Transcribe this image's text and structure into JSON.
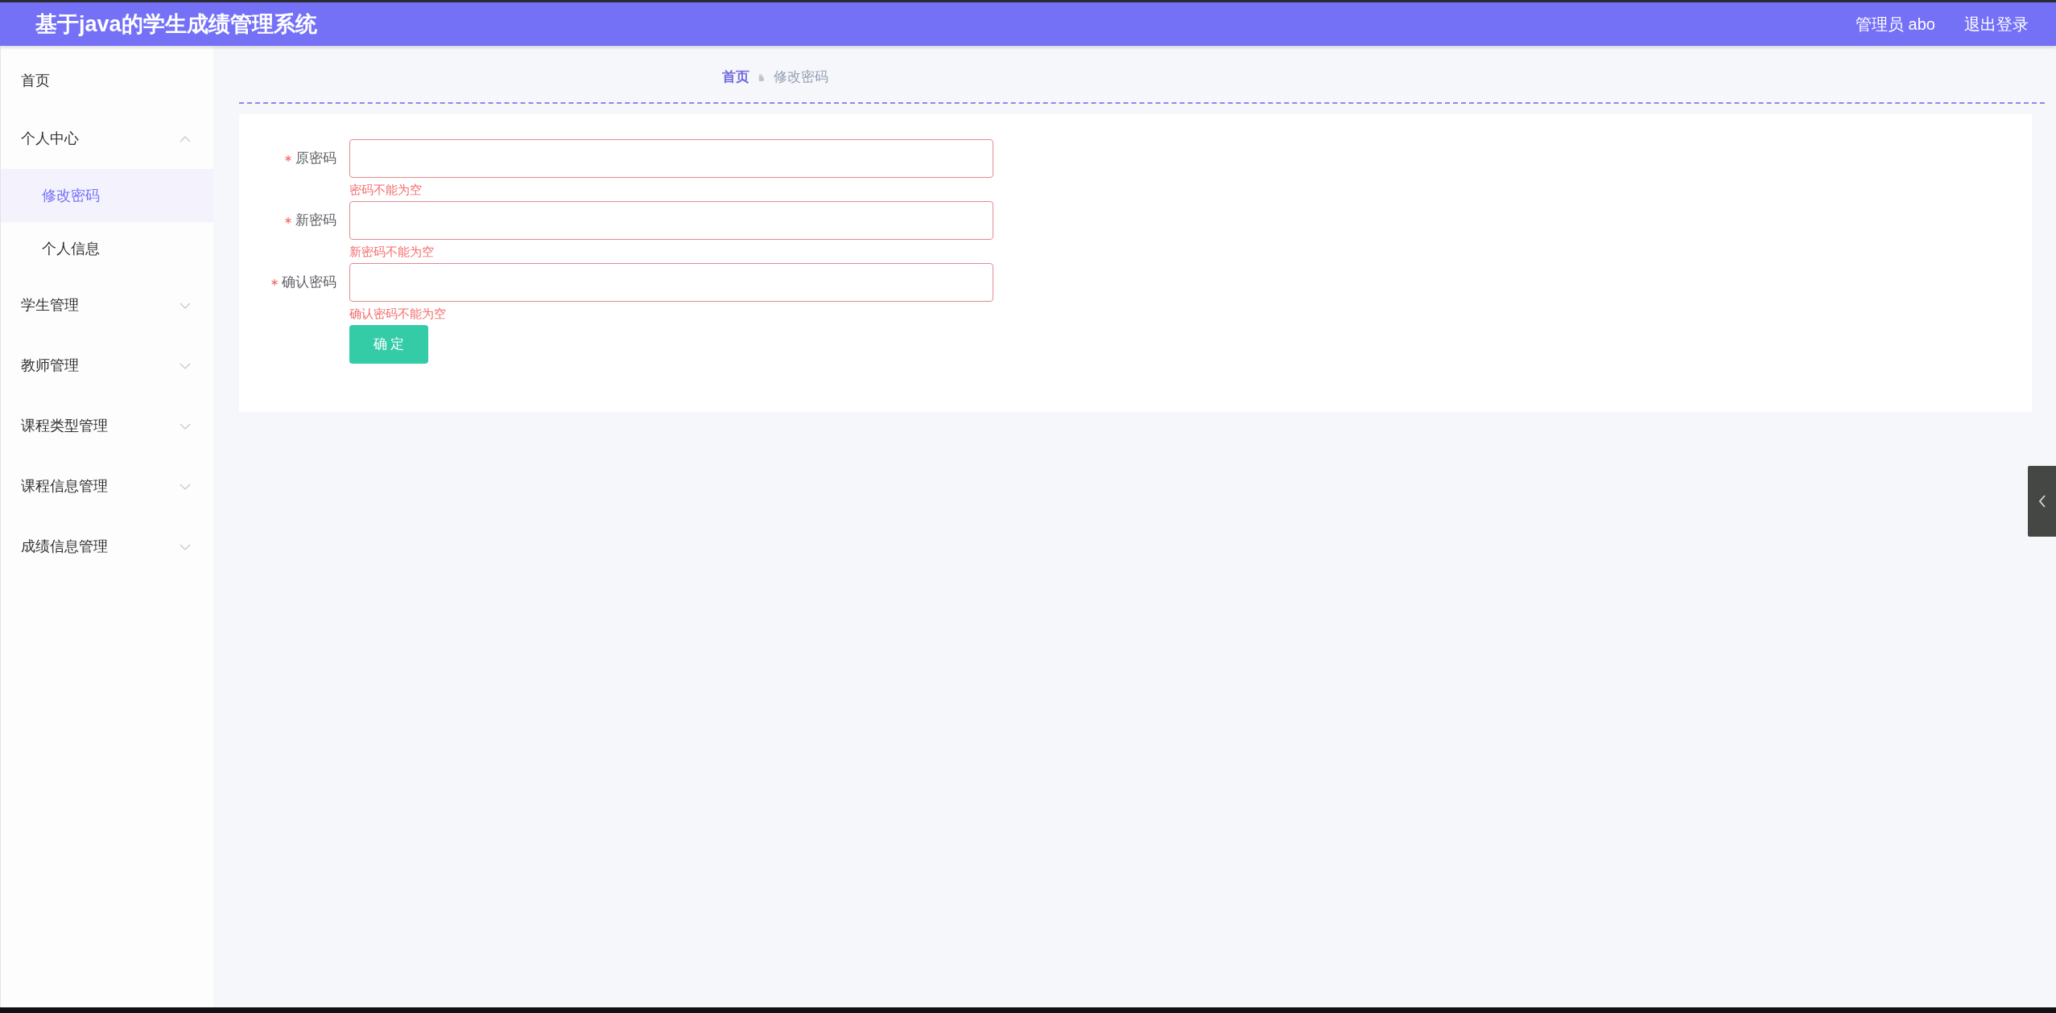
{
  "header": {
    "title": "基于java的学生成绩管理系统",
    "user": "管理员 abo",
    "logout": "退出登录"
  },
  "sidebar": {
    "items": [
      {
        "label": "首页",
        "kind": "link",
        "selected": false
      },
      {
        "label": "个人中心",
        "kind": "group",
        "expanded": true,
        "children": [
          {
            "label": "修改密码",
            "selected": true
          },
          {
            "label": "个人信息",
            "selected": false
          }
        ]
      },
      {
        "label": "学生管理",
        "kind": "group",
        "expanded": false
      },
      {
        "label": "教师管理",
        "kind": "group",
        "expanded": false
      },
      {
        "label": "课程类型管理",
        "kind": "group",
        "expanded": false
      },
      {
        "label": "课程信息管理",
        "kind": "group",
        "expanded": false
      },
      {
        "label": "成绩信息管理",
        "kind": "group",
        "expanded": false
      }
    ]
  },
  "breadcrumb": [
    {
      "label": "首页",
      "selected": false
    },
    {
      "label": "修改密码",
      "selected": true
    }
  ],
  "form": {
    "fields": [
      {
        "label": "原密码",
        "required": true,
        "error": "密码不能为空"
      },
      {
        "label": "新密码",
        "required": true,
        "error": "新密码不能为空"
      },
      {
        "label": "确认密码",
        "required": true,
        "error": "确认密码不能为空"
      }
    ],
    "submit": "确 定"
  }
}
